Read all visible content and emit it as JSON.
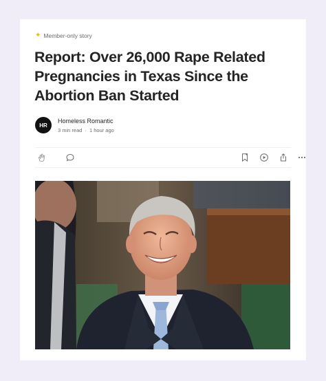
{
  "story": {
    "badge": "Member-only story",
    "title": "Report: Over 26,000 Rape Related Pregnancies in Texas Since the Abortion Ban Started"
  },
  "author": {
    "name": "Homeless Romantic",
    "read_time": "3 min read",
    "separator": "·",
    "posted": "1 hour ago"
  },
  "icons": {
    "clap": "clap-icon",
    "comment": "comment-icon",
    "bookmark": "bookmark-icon",
    "listen": "play-icon",
    "share": "share-icon",
    "more": "more-icon"
  },
  "colors": {
    "page_bg": "#f0ecf8",
    "card_bg": "#ffffff",
    "star": "#f5b400",
    "text": "#242424",
    "muted": "#6b6b6b"
  }
}
